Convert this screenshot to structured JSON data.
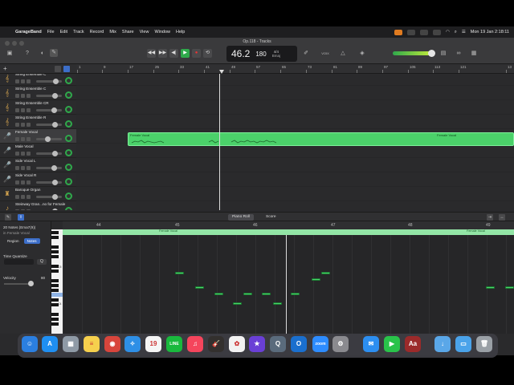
{
  "menubar": {
    "app": "GarageBand",
    "items": [
      "File",
      "Edit",
      "Track",
      "Record",
      "Mix",
      "Share",
      "View",
      "Window",
      "Help"
    ],
    "clock": "Mon 19 Jan  2:18:11"
  },
  "window": {
    "title": "Op.118 - Tracks"
  },
  "lcd": {
    "position": "46.2",
    "tempo": "180",
    "time_sig": "4/4",
    "key": "Bmaj"
  },
  "toolbar": {
    "voice_label": "VOIX"
  },
  "colors": {
    "region": "#4bd16a",
    "accent_blue": "#3c6ec9",
    "play": "#2fa94b",
    "note": "#49d46a"
  },
  "ruler": {
    "bars": [
      "1",
      "9",
      "17",
      "25",
      "33",
      "41",
      "49",
      "57",
      "65",
      "73",
      "81",
      "89",
      "97",
      "105",
      "113",
      "121",
      "13"
    ]
  },
  "tracks": [
    {
      "name": "String Ensemble C",
      "icon": "strings-icon",
      "fader": 0.85,
      "pan": "green"
    },
    {
      "name": "String Ensemble C",
      "icon": "strings-icon",
      "fader": 0.8,
      "pan": "green"
    },
    {
      "name": "String Ensemble CR",
      "icon": "strings-icon",
      "fader": 0.75,
      "pan": "green"
    },
    {
      "name": "String Ensemble R",
      "icon": "strings-icon",
      "fader": 0.8,
      "pan": "green"
    },
    {
      "name": "Female Vocal",
      "icon": "vocal-icon",
      "fader": 0.45,
      "pan": "green"
    },
    {
      "name": "Male Vocal",
      "icon": "vocal-icon",
      "fader": 0.8,
      "pan": "green"
    },
    {
      "name": "Side Vocal L",
      "icon": "vocal-icon",
      "fader": 0.75,
      "pan": "green"
    },
    {
      "name": "Side Vocal R",
      "icon": "vocal-icon",
      "fader": 0.8,
      "pan": "green"
    },
    {
      "name": "Baroque Organ",
      "icon": "organ-icon",
      "fader": 0.8,
      "pan": "green"
    },
    {
      "name": "Steinway Gran...no for Female",
      "icon": "piano-icon",
      "fader": 0.8,
      "pan": "green"
    }
  ],
  "region": {
    "label_left": "Female Vocal",
    "label_right": "Female Vocal"
  },
  "editor": {
    "tabs": [
      "Piano Roll",
      "Score"
    ],
    "summary": "20 Notes (Ema7(9))",
    "summary_sub": "in Female Vocal",
    "seg": [
      "Region",
      "Notes"
    ],
    "time_quantize": "Time Quantize",
    "quantize_btn": "Q",
    "velocity_label": "Velocity",
    "velocity_value": "80",
    "bars": [
      "44",
      "45",
      "46",
      "47",
      "48",
      "49"
    ],
    "strip_label": "Female Vocal",
    "key_labels": [
      "C5",
      "C4"
    ]
  },
  "dock": [
    {
      "name": "finder-icon",
      "glyph": "☺",
      "color": "#2b7fe0"
    },
    {
      "name": "app-store-icon",
      "glyph": "A",
      "color": "#1f8ff2"
    },
    {
      "name": "launchpad-icon",
      "glyph": "▦",
      "color": "#8f9aa6"
    },
    {
      "name": "notes-icon",
      "glyph": "≡",
      "color": "#f6d04d"
    },
    {
      "name": "chrome-icon",
      "glyph": "◉",
      "color": "#d8453c"
    },
    {
      "name": "safari-icon",
      "glyph": "✧",
      "color": "#2e8fe6"
    },
    {
      "name": "calendar-icon",
      "glyph": "19",
      "color": "#f5f5f5"
    },
    {
      "name": "line-icon",
      "glyph": "LINE",
      "color": "#19b93d"
    },
    {
      "name": "music-icon",
      "glyph": "♫",
      "color": "#f5455c"
    },
    {
      "name": "garageband-icon",
      "glyph": "🎸",
      "color": "#33302e"
    },
    {
      "name": "photos-icon",
      "glyph": "✿",
      "color": "#f2f2f2"
    },
    {
      "name": "imovie-icon",
      "glyph": "★",
      "color": "#6a3fd6"
    },
    {
      "name": "quicktime-icon",
      "glyph": "Q",
      "color": "#5a6b7c"
    },
    {
      "name": "outlook-icon",
      "glyph": "O",
      "color": "#1a6fce"
    },
    {
      "name": "zoom-icon",
      "glyph": "zoom",
      "color": "#2d8cff"
    },
    {
      "name": "system-settings-icon",
      "glyph": "⚙",
      "color": "#8a8a8f"
    },
    {
      "name": "mail-icon",
      "glyph": "✉",
      "color": "#2c8ef0"
    },
    {
      "name": "facetime-icon",
      "glyph": "▶",
      "color": "#29c34a"
    },
    {
      "name": "dictionary-icon",
      "glyph": "Aa",
      "color": "#9b2a2a"
    },
    {
      "name": "downloads-icon",
      "glyph": "↓",
      "color": "#5aa7e8"
    },
    {
      "name": "folder-icon",
      "glyph": "▭",
      "color": "#4aa3ea"
    },
    {
      "name": "trash-icon",
      "glyph": "🗑",
      "color": "#9aa0a6"
    }
  ]
}
